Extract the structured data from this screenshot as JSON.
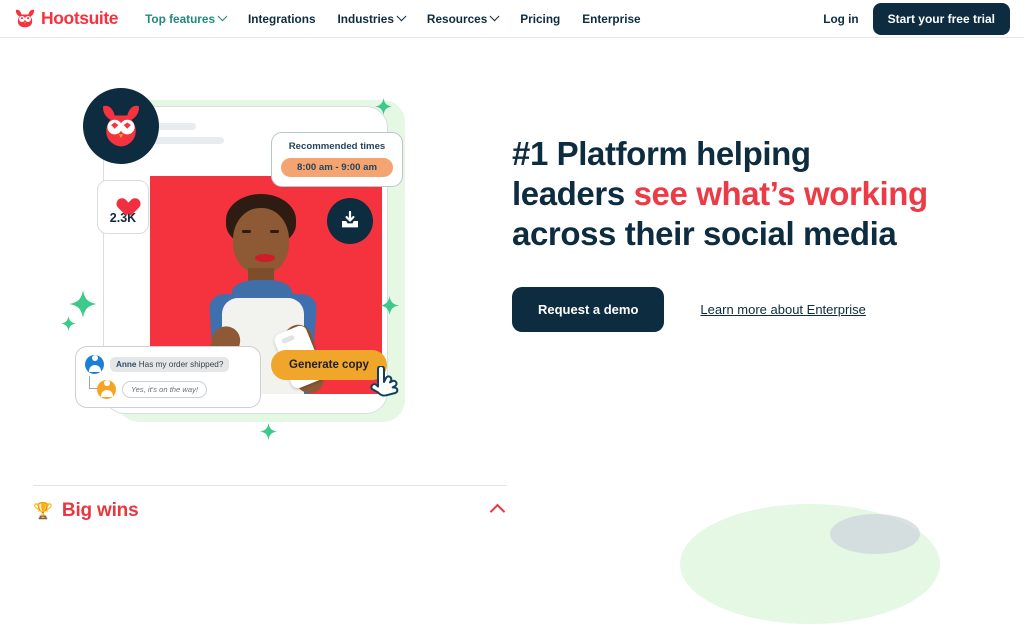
{
  "header": {
    "logo": {
      "text": "Hootsuite",
      "icon": "owl-logo-icon"
    },
    "nav": [
      {
        "label": "Top features",
        "has_caret": true,
        "active": true
      },
      {
        "label": "Integrations",
        "has_caret": false,
        "active": false
      },
      {
        "label": "Industries",
        "has_caret": true,
        "active": false
      },
      {
        "label": "Resources",
        "has_caret": true,
        "active": false
      },
      {
        "label": "Pricing",
        "has_caret": false,
        "active": false
      },
      {
        "label": "Enterprise",
        "has_caret": false,
        "active": false
      }
    ],
    "login_label": "Log in",
    "trial_label": "Start your free trial"
  },
  "hero": {
    "headline": {
      "part1": "#1 Platform helping leaders ",
      "highlight": "see what’s working",
      "part2": " across their social media"
    },
    "primary_cta": "Request a demo",
    "secondary_cta": "Learn more about Enterprise"
  },
  "illustration": {
    "likes_count": "2.3K",
    "recommended": {
      "title": "Recommended times",
      "slot": "8:00 am - 9:00 am"
    },
    "chat": {
      "sender_name": "Anne",
      "message": "Has my order shipped?",
      "reply": "Yes, it’s on the way!"
    },
    "generate_button": "Generate copy",
    "icons": {
      "owl": "owl-avatar-icon",
      "heart": "heart-icon",
      "download": "download-inbox-icon",
      "cursor": "hand-cursor-icon",
      "sparkle": "sparkle-icon"
    }
  },
  "bottom": {
    "trophy_emoji": "🏆",
    "section_title": "Big wins",
    "collapse_icon": "chevron-up-icon"
  },
  "colors": {
    "brand_red": "#f5333f",
    "headline_red": "#ec3a46",
    "navy": "#0d2c3f",
    "teal_active": "#1f8a7a",
    "orange_pill": "#f3a470",
    "generate_orange": "#f0a62a",
    "green_panel": "#e4f8e4",
    "sparkle_green": "#3cc98b"
  }
}
